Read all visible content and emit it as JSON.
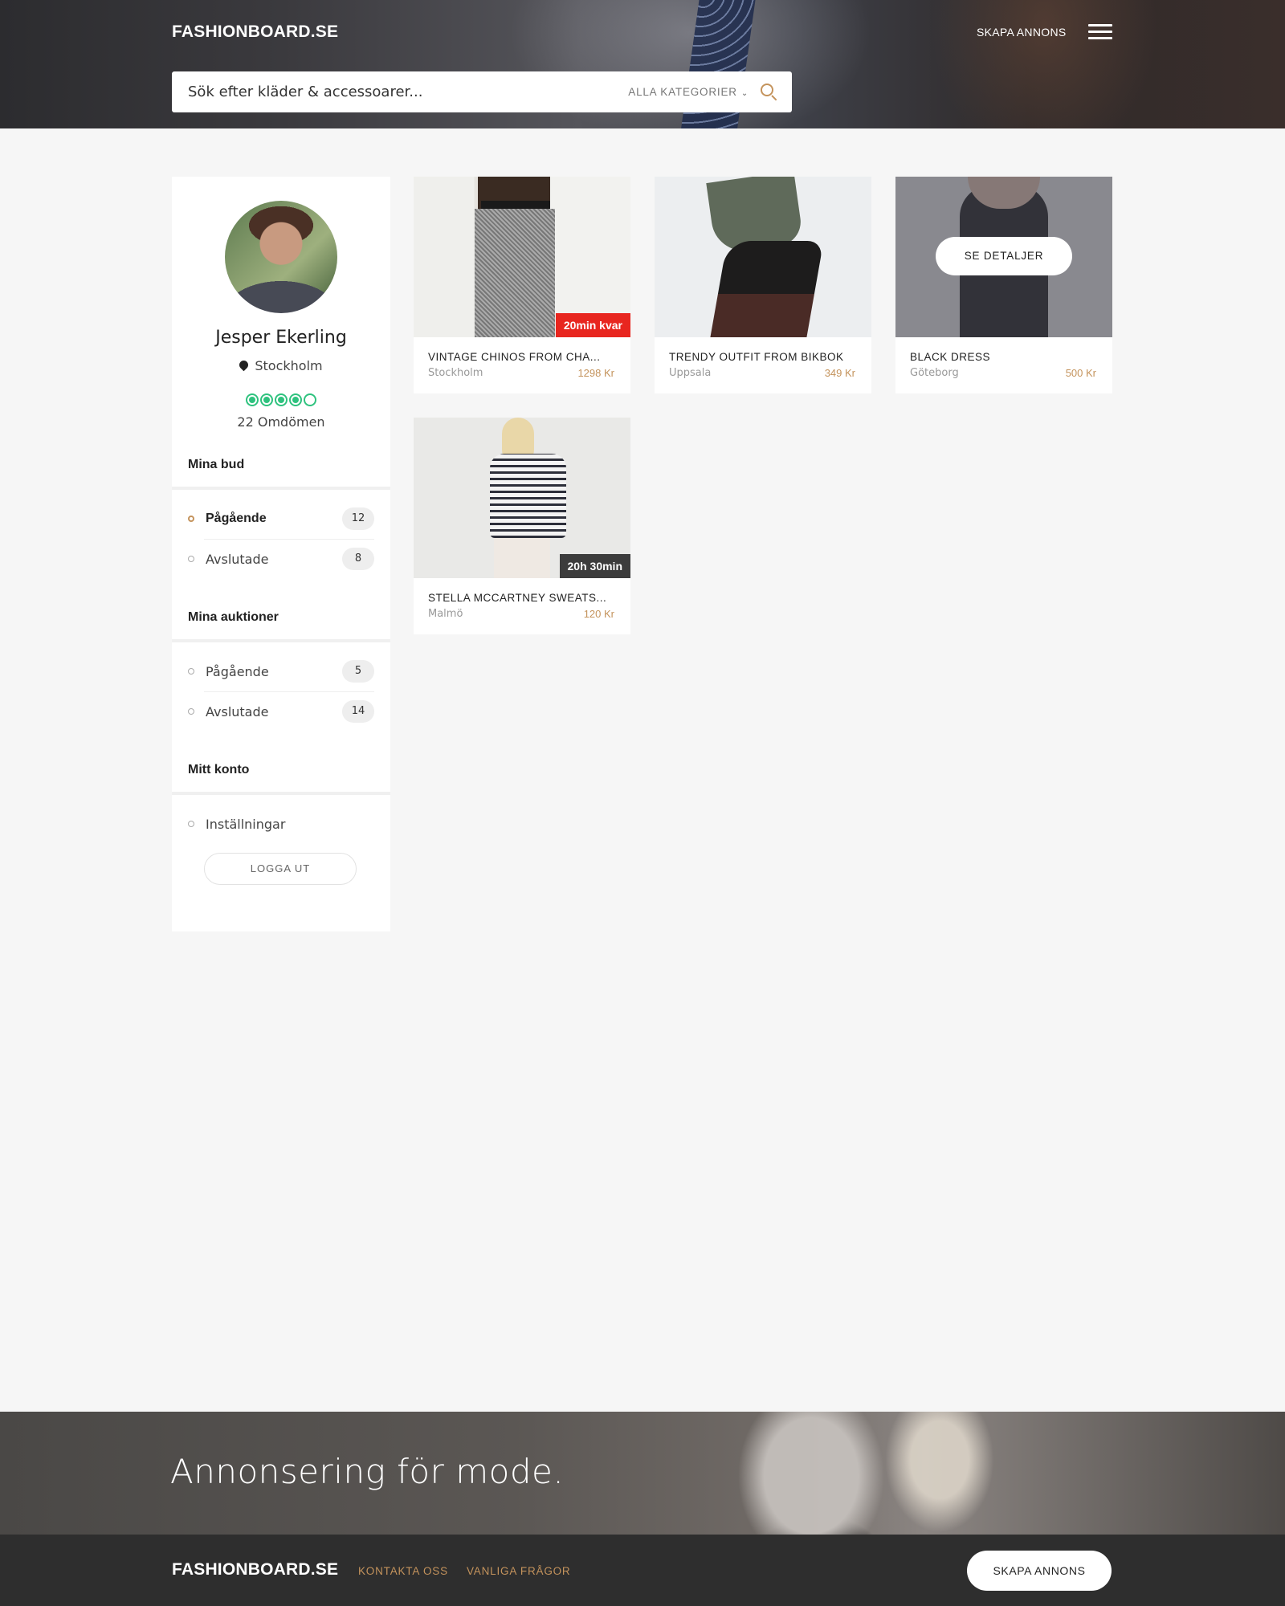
{
  "header": {
    "logo": "FASHIONBOARD.SE",
    "create_label": "SKAPA ANNONS",
    "search_placeholder": "Sök efter kläder & accessoarer...",
    "category_label": "ALLA KATEGORIER",
    "menu_icon": "hamburger-icon",
    "search_icon": "search-icon"
  },
  "profile": {
    "name": "Jesper Ekerling",
    "location": "Stockholm",
    "rating": 4,
    "rating_max": 5,
    "reviews": "22 Omdömen"
  },
  "sidebar": {
    "bids": {
      "title": "Mina bud",
      "items": [
        {
          "label": "Pågående",
          "count": "12",
          "active": true
        },
        {
          "label": "Avslutade",
          "count": "8",
          "active": false
        }
      ]
    },
    "auctions": {
      "title": "Mina auktioner",
      "items": [
        {
          "label": "Pågående",
          "count": "5"
        },
        {
          "label": "Avslutade",
          "count": "14"
        }
      ]
    },
    "account": {
      "title": "Mitt konto",
      "settings": "Inställningar",
      "logout": "LOGGA UT"
    }
  },
  "products": [
    {
      "title": "VINTAGE CHINOS FROM CHA...",
      "city": "Stockholm",
      "price": "1298 Kr",
      "timer": "20min kvar"
    },
    {
      "title": "TRENDY OUTFIT FROM BIKBOK",
      "city": "Uppsala",
      "price": "349 Kr"
    },
    {
      "title": "BLACK DRESS",
      "city": "Göteborg",
      "price": "500 Kr",
      "hover_label": "SE DETALJER"
    },
    {
      "title": "STELLA MCCARTNEY SWEATS...",
      "city": "Malmö",
      "price": "120 Kr",
      "timer": "20h 30min"
    }
  ],
  "footer": {
    "tagline": "Annonsering för mode.",
    "logo": "FASHIONBOARD.SE",
    "links": [
      "KONTAKTA OSS",
      "VANLIGA FRÅGOR"
    ],
    "create_label": "SKAPA ANNONS"
  },
  "colors": {
    "accent": "#c4935c",
    "rating": "#2ec27e",
    "timer_urgent": "#e8261f",
    "timer_normal": "#3c3c3c"
  }
}
